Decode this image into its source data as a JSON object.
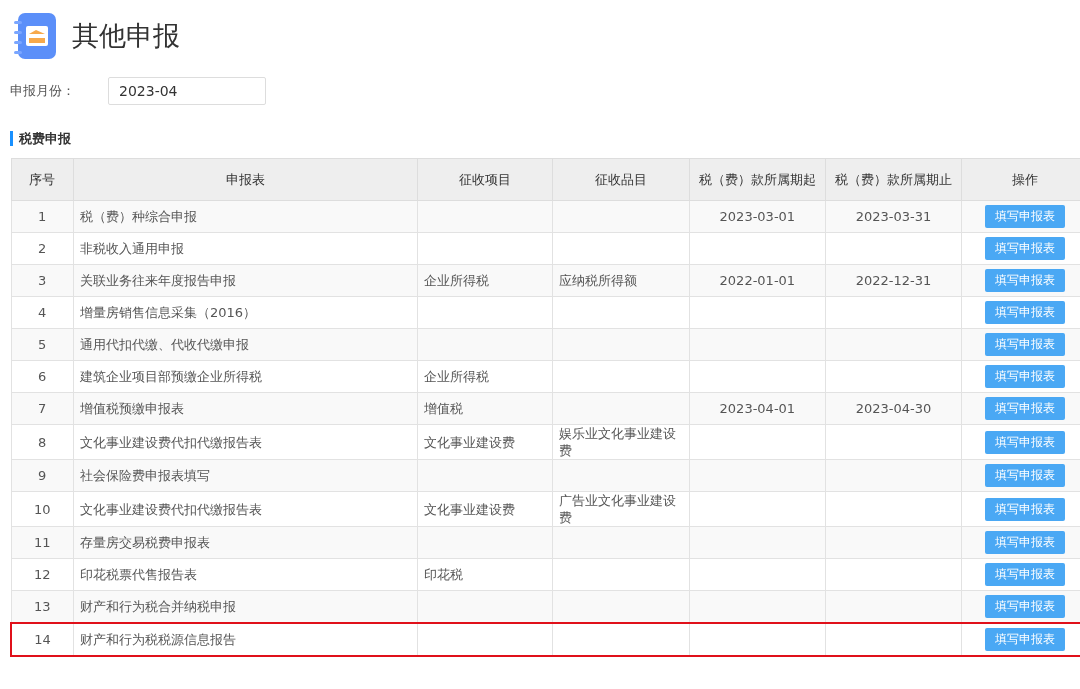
{
  "page_title": "其他申报",
  "month_field": {
    "label": "申报月份：",
    "value": "2023-04"
  },
  "section_title": "税费申报",
  "table": {
    "columns": [
      "序号",
      "申报表",
      "征收项目",
      "征收品目",
      "税（费）款所属期起",
      "税（费）款所属期止",
      "操作"
    ],
    "rows": [
      {
        "no": "1",
        "form": "税（费）种综合申报",
        "item": "",
        "subitem": "",
        "start": "2023-03-01",
        "end": "2023-03-31",
        "action": "填写申报表",
        "highlighted": false
      },
      {
        "no": "2",
        "form": "非税收入通用申报",
        "item": "",
        "subitem": "",
        "start": "",
        "end": "",
        "action": "填写申报表",
        "highlighted": false
      },
      {
        "no": "3",
        "form": "关联业务往来年度报告申报",
        "item": "企业所得税",
        "subitem": "应纳税所得额",
        "start": "2022-01-01",
        "end": "2022-12-31",
        "action": "填写申报表",
        "highlighted": false
      },
      {
        "no": "4",
        "form": "增量房销售信息采集（2016）",
        "item": "",
        "subitem": "",
        "start": "",
        "end": "",
        "action": "填写申报表",
        "highlighted": false
      },
      {
        "no": "5",
        "form": "通用代扣代缴、代收代缴申报",
        "item": "",
        "subitem": "",
        "start": "",
        "end": "",
        "action": "填写申报表",
        "highlighted": false
      },
      {
        "no": "6",
        "form": "建筑企业项目部预缴企业所得税",
        "item": "企业所得税",
        "subitem": "",
        "start": "",
        "end": "",
        "action": "填写申报表",
        "highlighted": false
      },
      {
        "no": "7",
        "form": "增值税预缴申报表",
        "item": "增值税",
        "subitem": "",
        "start": "2023-04-01",
        "end": "2023-04-30",
        "action": "填写申报表",
        "highlighted": false
      },
      {
        "no": "8",
        "form": "文化事业建设费代扣代缴报告表",
        "item": "文化事业建设费",
        "subitem": "娱乐业文化事业建设费",
        "start": "",
        "end": "",
        "action": "填写申报表",
        "highlighted": false
      },
      {
        "no": "9",
        "form": "社会保险费申报表填写",
        "item": "",
        "subitem": "",
        "start": "",
        "end": "",
        "action": "填写申报表",
        "highlighted": false
      },
      {
        "no": "10",
        "form": "文化事业建设费代扣代缴报告表",
        "item": "文化事业建设费",
        "subitem": "广告业文化事业建设费",
        "start": "",
        "end": "",
        "action": "填写申报表",
        "highlighted": false
      },
      {
        "no": "11",
        "form": "存量房交易税费申报表",
        "item": "",
        "subitem": "",
        "start": "",
        "end": "",
        "action": "填写申报表",
        "highlighted": false
      },
      {
        "no": "12",
        "form": "印花税票代售报告表",
        "item": "印花税",
        "subitem": "",
        "start": "",
        "end": "",
        "action": "填写申报表",
        "highlighted": false
      },
      {
        "no": "13",
        "form": "财产和行为税合并纳税申报",
        "item": "",
        "subitem": "",
        "start": "",
        "end": "",
        "action": "填写申报表",
        "highlighted": false
      },
      {
        "no": "14",
        "form": "财产和行为税税源信息报告",
        "item": "",
        "subitem": "",
        "start": "",
        "end": "",
        "action": "填写申报表",
        "highlighted": true
      }
    ]
  }
}
